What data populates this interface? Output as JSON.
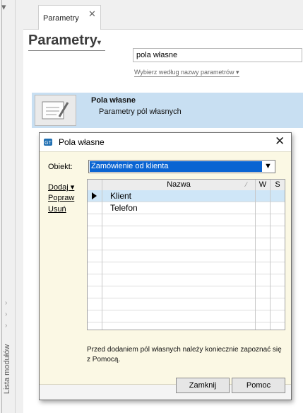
{
  "sidebar": {
    "module_list_label": "Lista modułów"
  },
  "tab": {
    "label": "Parametry",
    "close": "✕"
  },
  "page": {
    "title": "Parametry",
    "search_value": "pola własne",
    "search_hint": "Wybierz według nazwy parametrów"
  },
  "result": {
    "title": "Pola własne",
    "subtitle": "Parametry pól własnych"
  },
  "dialog": {
    "title": "Pola własne",
    "close": "✕",
    "object_label": "Obiekt:",
    "object_value": "Zamówienie od klienta",
    "actions": {
      "add": "Dodaj",
      "edit": "Popraw",
      "delete": "Usuń"
    },
    "columns": {
      "name": "Nazwa",
      "w": "W",
      "s": "S"
    },
    "rows": [
      "Klient",
      "Telefon"
    ],
    "note": "Przed dodaniem pól własnych należy koniecznie zapoznać się z Pomocą.",
    "buttons": {
      "close": "Zamknij",
      "help": "Pomoc"
    }
  },
  "colors": {
    "selection": "#0a64d2",
    "result_bg": "#c8dff2",
    "dialog_bg": "#fbf8e4"
  },
  "icons": [
    "chevron-right-icon",
    "dropdown-arrow-icon",
    "close-icon",
    "parameters-icon",
    "app-icon",
    "row-pointer-icon"
  ]
}
